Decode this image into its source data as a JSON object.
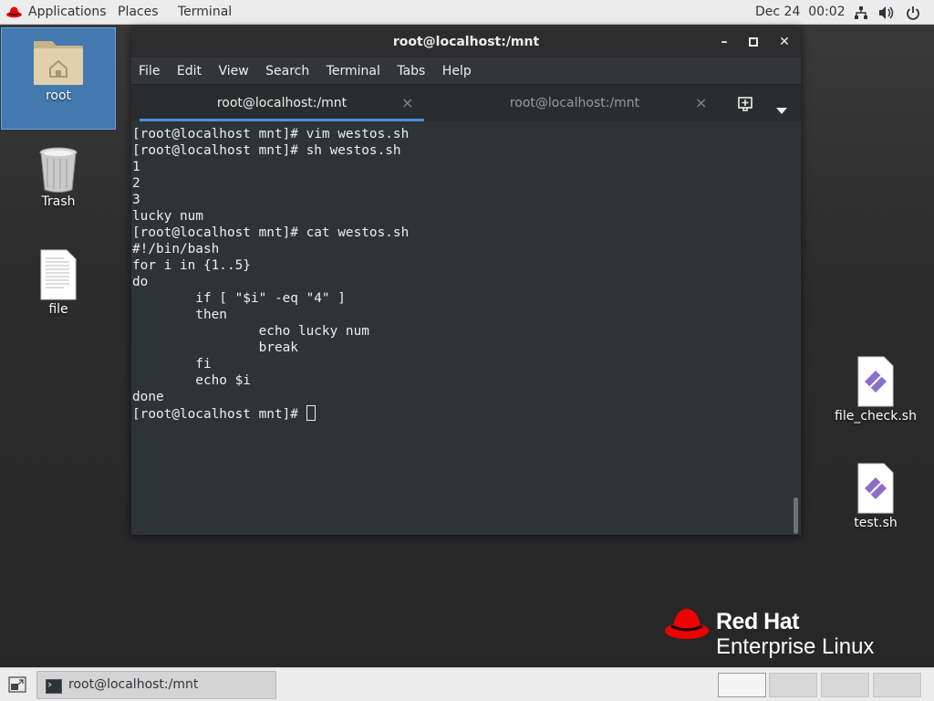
{
  "topbar": {
    "applications": "Applications",
    "places": "Places",
    "terminal": "Terminal",
    "datetime": "Dec 24  00:02",
    "icons": [
      "network-icon",
      "volume-icon",
      "power-icon"
    ]
  },
  "desktop": {
    "icons": [
      {
        "label": "root",
        "icon": "home-folder-icon"
      },
      {
        "label": "Trash",
        "icon": "trash-icon"
      },
      {
        "label": "file",
        "icon": "text-file-icon"
      },
      {
        "label": "file_check.sh",
        "icon": "script-file-icon"
      },
      {
        "label": "test.sh",
        "icon": "script-file-icon"
      }
    ]
  },
  "window": {
    "title": "root@localhost:/mnt",
    "menu": [
      "File",
      "Edit",
      "View",
      "Search",
      "Terminal",
      "Tabs",
      "Help"
    ],
    "tabs": [
      {
        "label": "root@localhost:/mnt",
        "active": true
      },
      {
        "label": "root@localhost:/mnt",
        "active": false
      }
    ],
    "lines": [
      "[root@localhost mnt]# vim westos.sh",
      "[root@localhost mnt]# sh westos.sh",
      "1",
      "2",
      "3",
      "lucky num",
      "[root@localhost mnt]# cat westos.sh",
      "#!/bin/bash",
      "for i in {1..5}",
      "do",
      "        if [ \"$i\" -eq \"4\" ]",
      "        then",
      "                echo lucky num",
      "                break",
      "        fi",
      "        echo $i",
      "done"
    ],
    "prompt": "[root@localhost mnt]# "
  },
  "brand": {
    "line1": "Red Hat",
    "line2": "Enterprise Linux",
    "color": "#ee0000"
  },
  "taskbar": {
    "window_label": "root@localhost:/mnt",
    "workspaces": 4,
    "active_workspace": 1
  }
}
